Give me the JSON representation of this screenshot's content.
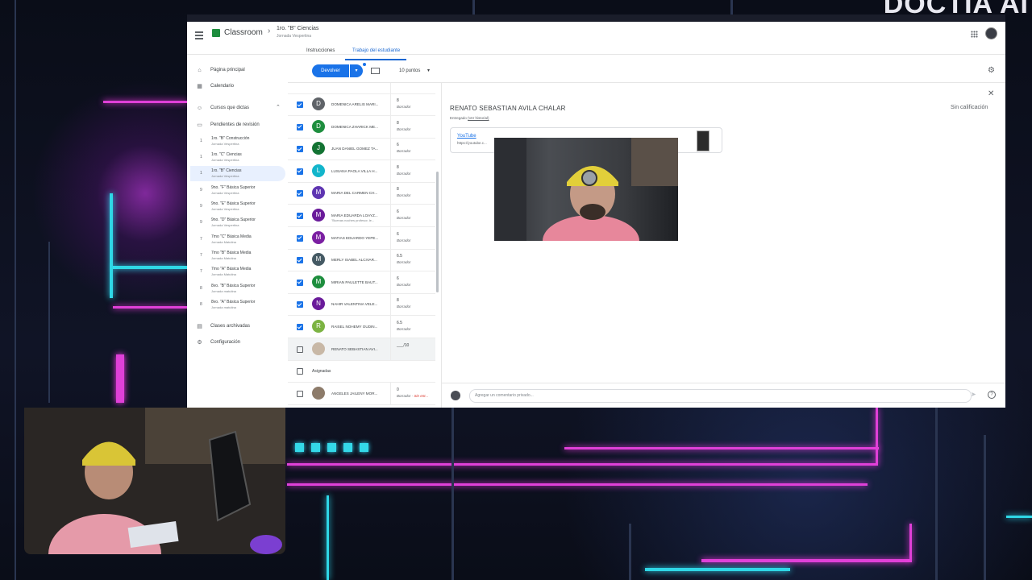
{
  "overlay": {
    "brand_text": "DOCTIA AI"
  },
  "app": {
    "name": "Classroom",
    "course_title": "1ro. \"B\" Ciencias",
    "course_subtitle": "Jornada Vespertina"
  },
  "tabs": [
    {
      "label": "Instrucciones"
    },
    {
      "label": "Trabajo del estudiante",
      "active": true
    }
  ],
  "sidebar": {
    "home": "Página principal",
    "calendar": "Calendario",
    "teaching": "Cursos que dictas",
    "review": "Pendientes de revisión",
    "courses": [
      {
        "num": "1",
        "title": "1ro. \"B\" Construcción",
        "sub": "Jornada Vespertina"
      },
      {
        "num": "1",
        "title": "1ro. \"C\" Ciencias",
        "sub": "Jornada Vespertina"
      },
      {
        "num": "1",
        "title": "1ro. \"B\" Ciencias",
        "sub": "Jornada Vespertina",
        "active": true
      },
      {
        "num": "9",
        "title": "9no. \"F\" Básica Superior",
        "sub": "Jornada Vespertina"
      },
      {
        "num": "9",
        "title": "9no. \"E\" Básica Superior",
        "sub": "Jornada Vespertina"
      },
      {
        "num": "9",
        "title": "9no. \"D\" Básica Superior",
        "sub": "Jornada Vespertina"
      },
      {
        "num": "7",
        "title": "7mo \"C\" Básica Media",
        "sub": "Jornada Matutina"
      },
      {
        "num": "7",
        "title": "7mo \"B\" Básica Media",
        "sub": "Jornada Matutina"
      },
      {
        "num": "7",
        "title": "7mo \"A\" Básica Media",
        "sub": "Jornada Matutina"
      },
      {
        "num": "8",
        "title": "8vo. \"B\" Básica Superior",
        "sub": "Jornada matutina"
      },
      {
        "num": "8",
        "title": "8vo. \"A\" Básica Superior",
        "sub": "Jornada matutina"
      }
    ],
    "archived": "Clases archivadas",
    "settings": "Configuración"
  },
  "toolbar": {
    "return_label": "Devolver",
    "points_label": "10 puntos"
  },
  "students": [
    {
      "initial": "D",
      "name": "DOMENICA ARELIS MARI...",
      "grade": "8",
      "status": "Borrador",
      "color": "#5f6368",
      "checked": true
    },
    {
      "initial": "D",
      "name": "DOMENICA ZHARICK ME...",
      "grade": "8",
      "status": "Borrador",
      "color": "#1e8e3e",
      "checked": true
    },
    {
      "initial": "J",
      "name": "JUAN DANIEL GOMEZ TA...",
      "grade": "6",
      "status": "Borrador",
      "color": "#137333",
      "checked": true
    },
    {
      "initial": "L",
      "name": "LUSIANA PAOLA VILLA H...",
      "grade": "8",
      "status": "Borrador",
      "color": "#12b5cb",
      "checked": true
    },
    {
      "initial": "M",
      "name": "MARIA DEL CARMEN CH...",
      "grade": "8",
      "status": "Borrador",
      "color": "#5e35b1",
      "checked": true
    },
    {
      "initial": "M",
      "name": "MARIA EDUARDA LOAYZ...",
      "name2": "\"Buenas noches profesor, le...",
      "grade": "6",
      "status": "Borrador",
      "color": "#6a1b9a",
      "checked": true
    },
    {
      "initial": "M",
      "name": "MATIAS EDUARDO YEPE...",
      "grade": "6",
      "status": "Borrador",
      "color": "#7b1fa2",
      "checked": true
    },
    {
      "initial": "M",
      "name": "MERLY ISABEL ALCIVAR...",
      "grade": "6.5",
      "status": "Borrador",
      "color": "#455a64",
      "checked": true
    },
    {
      "initial": "M",
      "name": "MIRIAN PAULETTE BAUT...",
      "grade": "6",
      "status": "Borrador",
      "color": "#1e8e3e",
      "checked": true
    },
    {
      "initial": "N",
      "name": "NAHIR VALENTINA VELE...",
      "grade": "8",
      "status": "Borrador",
      "color": "#6a1b9a",
      "checked": true
    },
    {
      "initial": "R",
      "name": "RAISEL NOHEMY OUDIN...",
      "grade": "6.5",
      "status": "Borrador",
      "color": "#7cb342",
      "checked": true
    },
    {
      "initial": "",
      "name": "RENATO SEBASTIAN AVI...",
      "grade": "___/10",
      "status": "",
      "color": "#c8b8a6",
      "checked": false,
      "selected": true
    }
  ],
  "assigned_section": "Asignadas",
  "assigned_students": [
    {
      "initial": "",
      "name": "ANGELES JAILENY MOR...",
      "grade": "0",
      "status": "Borrador",
      "status_late": "Sin ent...",
      "color": "#8d7b6a",
      "checked": false
    }
  ],
  "detail": {
    "student_name": "RENATO SEBASTIAN AVILA CHALAR",
    "grade_status": "Sin calificación",
    "handed_in": "Entregado",
    "history_link": "(Ver historial)",
    "attachment_title": "YouTube",
    "attachment_url": "https://youtube.c...",
    "comment_placeholder": "Agregar un comentario privado..."
  }
}
